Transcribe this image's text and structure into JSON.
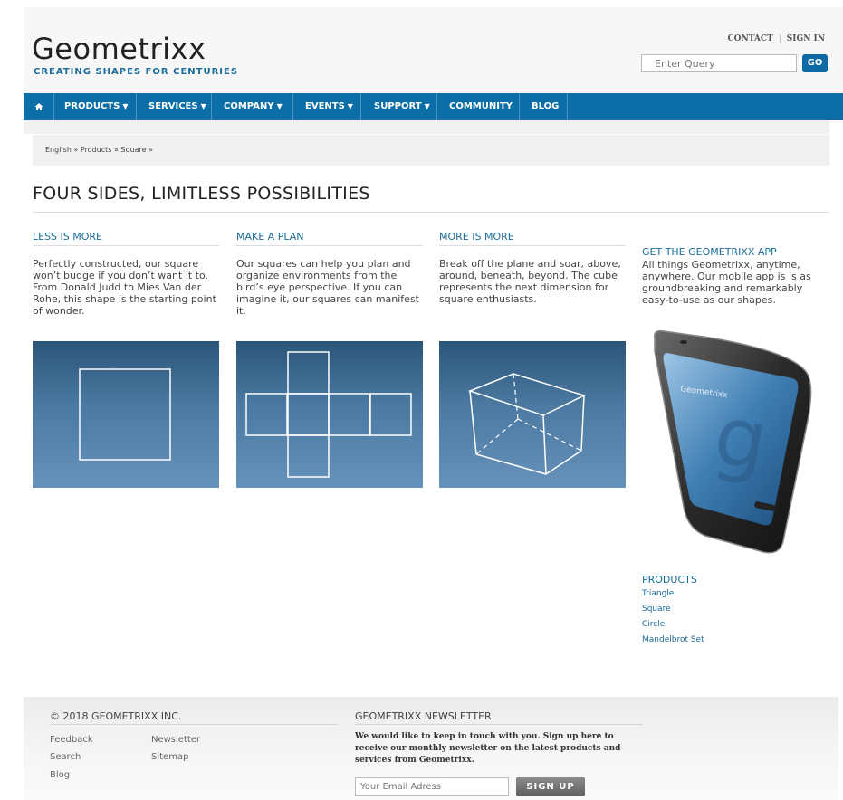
{
  "header": {
    "logo_title": "Geometrixx",
    "logo_subtitle": "CREATING SHAPES FOR CENTURIES",
    "contact": "CONTACT",
    "sign_in": "SIGN IN",
    "search_placeholder": "Enter Query",
    "go_label": "GO"
  },
  "nav": {
    "home_icon": "home-icon",
    "items": [
      {
        "label": "PRODUCTS",
        "arrow": "▼"
      },
      {
        "label": "SERVICES",
        "arrow": "▼"
      },
      {
        "label": "COMPANY",
        "arrow": "▼"
      },
      {
        "label": "EVENTS",
        "arrow": "▼"
      },
      {
        "label": "SUPPORT",
        "arrow": "▼"
      },
      {
        "label": "COMMUNITY",
        "arrow": ""
      },
      {
        "label": "BLOG",
        "arrow": ""
      }
    ]
  },
  "breadcrumb": "English » Products » Square »",
  "main": {
    "title": "FOUR SIDES, LIMITLESS POSSIBILITIES",
    "columns": [
      {
        "heading": "LESS IS MORE",
        "text": "Perfectly constructed, our square won’t budge if you don’t want it to. From Donald Judd to Mies Van der Rohe, this shape is the starting point of wonder.",
        "image": "square-outline"
      },
      {
        "heading": "MAKE A PLAN",
        "text": "Our squares can help you plan and organize environments from the bird’s eye perspective. If you can imagine it, our squares can manifest it.",
        "image": "cube-net"
      },
      {
        "heading": "MORE IS MORE",
        "text": "Break off the plane and soar, above, around, beneath, beyond. The cube represents the next dimension for square enthusiasts.",
        "image": "wireframe-cube"
      }
    ]
  },
  "sidebar": {
    "app_heading": "GET THE GEOMETRIXX APP",
    "app_text": "All things Geometrixx, anytime, anywhere. Our mobile app is is as groundbreaking and remarkably easy-to-use as our shapes.",
    "phone_screen_text": "Geometrixx",
    "products_heading": "PRODUCTS",
    "products": [
      "Triangle",
      "Square",
      "Circle",
      "Mandelbrot Set"
    ]
  },
  "footer": {
    "copyright": "© 2018 GEOMETRIXX INC.",
    "links": [
      "Feedback",
      "Newsletter",
      "Search",
      "Sitemap",
      "Blog"
    ],
    "newsletter_title": "GEOMETRIXX NEWSLETTER",
    "newsletter_text": "We would like to keep in touch with you. Sign up here to receive our monthly newsletter on the latest products and services from Geometrixx.",
    "email_placeholder": "Your Email Adress",
    "signup_label": "SIGN UP"
  },
  "colors": {
    "brand_blue": "#0b6ea6",
    "link_blue": "#1a6b9a",
    "tile_top": "#2b5578",
    "tile_bottom": "#6691ba"
  }
}
